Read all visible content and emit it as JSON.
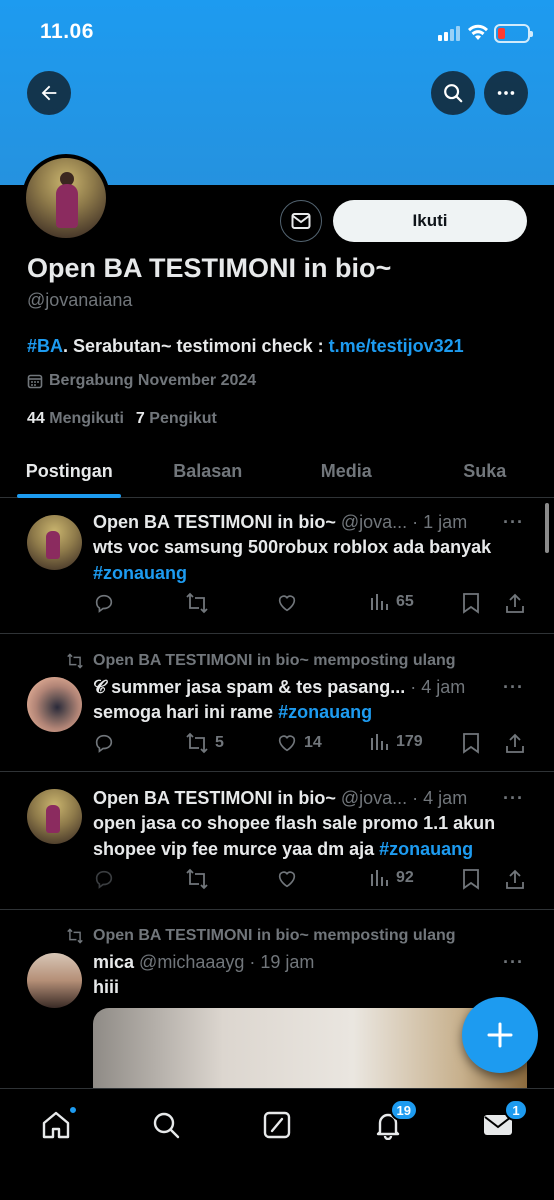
{
  "status_bar": {
    "time": "11.06"
  },
  "profile": {
    "display_name": "Open BA TESTIMONI in bio~",
    "handle": "@jovanaiana",
    "follow_label": "Ikuti",
    "bio_tag": "#BA",
    "bio_text": ". Serabutan~ testimoni check : ",
    "bio_link": "t.me/testijov321",
    "joined": "Bergabung November 2024",
    "following_count": "44",
    "following_label": "Mengikuti",
    "followers_count": "7",
    "followers_label": "Pengikut"
  },
  "tabs": [
    {
      "label": "Postingan",
      "active": true
    },
    {
      "label": "Balasan"
    },
    {
      "label": "Media"
    },
    {
      "label": "Suka"
    }
  ],
  "posts": [
    {
      "name": "Open BA TESTIMONI in bio~",
      "handle": "@jova...",
      "time": "· 1 jam",
      "text": "wts voc samsung 500robux roblox ada banyak",
      "hashtag": "#zonauang",
      "replies": "",
      "reposts": "",
      "likes": "",
      "views": "65"
    },
    {
      "repost_note": "Open BA TESTIMONI in bio~ memposting ulang",
      "name": "𝒞 summer jasa spam & tes pasang...",
      "time": "· 4 jam",
      "text": "semoga hari ini rame",
      "hashtag": "#zonauang",
      "replies": "",
      "reposts": "5",
      "likes": "14",
      "views": "179"
    },
    {
      "name": "Open BA TESTIMONI in bio~",
      "handle": "@jova...",
      "time": "· 4 jam",
      "text": "open jasa co shopee flash sale promo 1.1 akun shopee vip fee murce yaa dm aja",
      "hashtag": "#zonauang",
      "replies": "",
      "reposts": "",
      "likes": "",
      "views": "92"
    },
    {
      "repost_note": "Open BA TESTIMONI in bio~ memposting ulang",
      "name": "mica",
      "handle": "@michaaayg",
      "time": "· 19 jam",
      "text": "hiii"
    }
  ],
  "more_glyph": "···",
  "nav": {
    "notifications_badge": "19",
    "messages_badge": "1"
  },
  "colors": {
    "accent": "#1d9bf0",
    "background": "#000000",
    "muted": "#71767b"
  }
}
